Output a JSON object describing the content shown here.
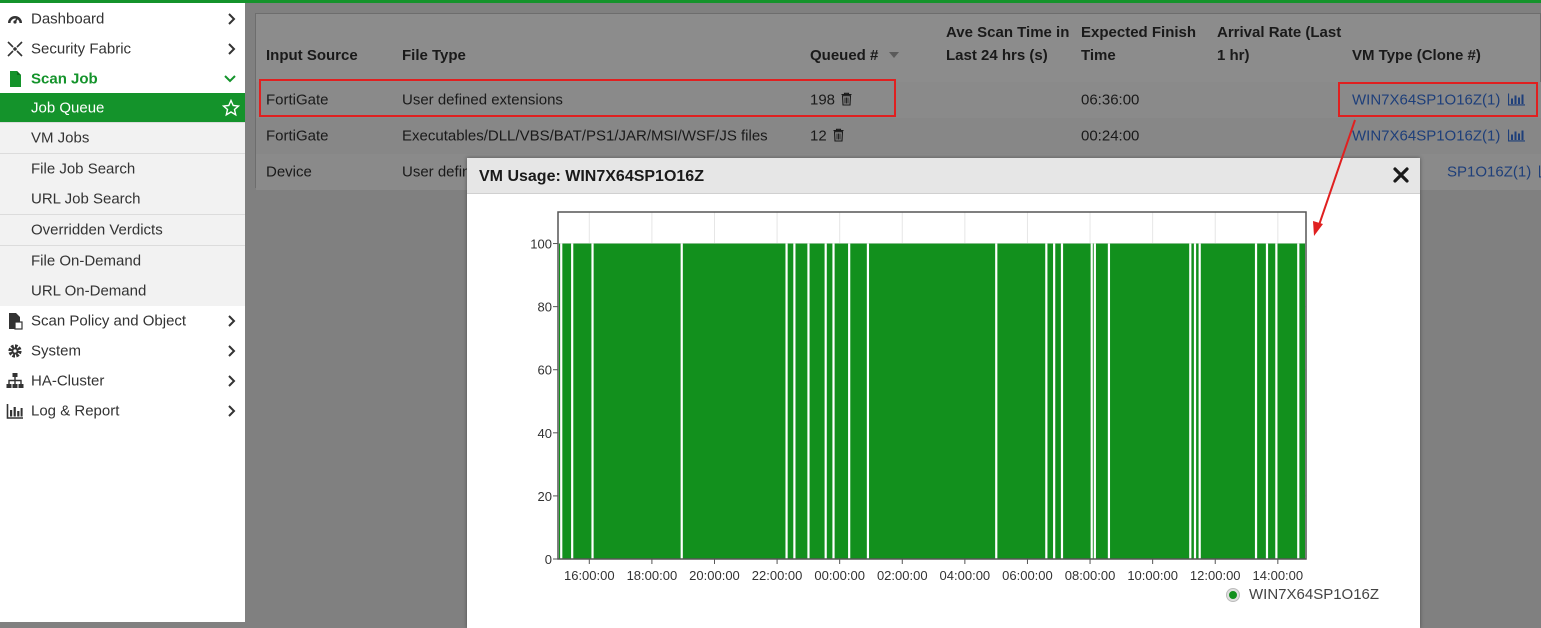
{
  "sidebar": {
    "items": [
      {
        "label": "Dashboard",
        "icon": "dashboard-icon"
      },
      {
        "label": "Security Fabric",
        "icon": "security-fabric-icon"
      },
      {
        "label": "Scan Job",
        "icon": "file-icon"
      },
      {
        "label": "Job Queue"
      },
      {
        "label": "VM Jobs"
      },
      {
        "label": "File Job Search"
      },
      {
        "label": "URL Job Search"
      },
      {
        "label": "Overridden Verdicts"
      },
      {
        "label": "File On-Demand"
      },
      {
        "label": "URL On-Demand"
      },
      {
        "label": "Scan Policy and Object",
        "icon": "scan-policy-icon"
      },
      {
        "label": "System",
        "icon": "gear-icon"
      },
      {
        "label": "HA-Cluster",
        "icon": "sitemap-icon"
      },
      {
        "label": "Log & Report",
        "icon": "bar-chart-icon"
      }
    ]
  },
  "table": {
    "headers": {
      "input_source": "Input Source",
      "file_type": "File Type",
      "queued": "Queued #",
      "ave_scan_1": "Ave Scan Time in",
      "ave_scan_2": "Last 24 hrs (s)",
      "expected_1": "Expected Finish",
      "expected_2": "Time",
      "arrival_1": "Arrival Rate (Last",
      "arrival_2": "1 hr)",
      "vm_type": "VM Type (Clone #)"
    },
    "rows": [
      {
        "input_source": "FortiGate",
        "file_type": "User defined extensions",
        "queued": "198",
        "expected": "06:36:00",
        "vm_type": "WIN7X64SP1O16Z(1)"
      },
      {
        "input_source": "FortiGate",
        "file_type": "Executables/DLL/VBS/BAT/PS1/JAR/MSI/WSF/JS files",
        "queued": "12",
        "expected": "00:24:00",
        "vm_type": "WIN7X64SP1O16Z(1)"
      },
      {
        "input_source": "Device",
        "file_type": "User defin",
        "queued": "",
        "expected": "",
        "vm_type": "SP1O16Z(1)"
      }
    ]
  },
  "modal": {
    "title": "VM Usage: WIN7X64SP1O16Z",
    "legend": "WIN7X64SP1O16Z"
  },
  "chart_data": {
    "type": "area",
    "title": "",
    "xlabel": "",
    "ylabel": "",
    "ylim": [
      0,
      110
    ],
    "y_ticks": [
      "0",
      "20",
      "40",
      "60",
      "80",
      "100"
    ],
    "x_ticks": [
      "16:00:00",
      "18:00:00",
      "20:00:00",
      "22:00:00",
      "00:00:00",
      "02:00:00",
      "04:00:00",
      "06:00:00",
      "08:00:00",
      "10:00:00",
      "12:00:00",
      "14:00:00"
    ],
    "x_range_hours": [
      15.0,
      38.9
    ],
    "series": [
      {
        "name": "WIN7X64SP1O16Z",
        "color": "#12901d",
        "level": 100,
        "gaps_hours": [
          15.1,
          15.45,
          16.1,
          18.95,
          22.3,
          22.55,
          23.0,
          23.55,
          23.8,
          24.3,
          24.9,
          29.0,
          30.6,
          30.85,
          31.1,
          32.05,
          32.15,
          32.6,
          35.2,
          35.35,
          35.5,
          37.3,
          37.65,
          37.95,
          38.65
        ]
      }
    ],
    "grid": true,
    "legend_position": "bottom-right"
  }
}
